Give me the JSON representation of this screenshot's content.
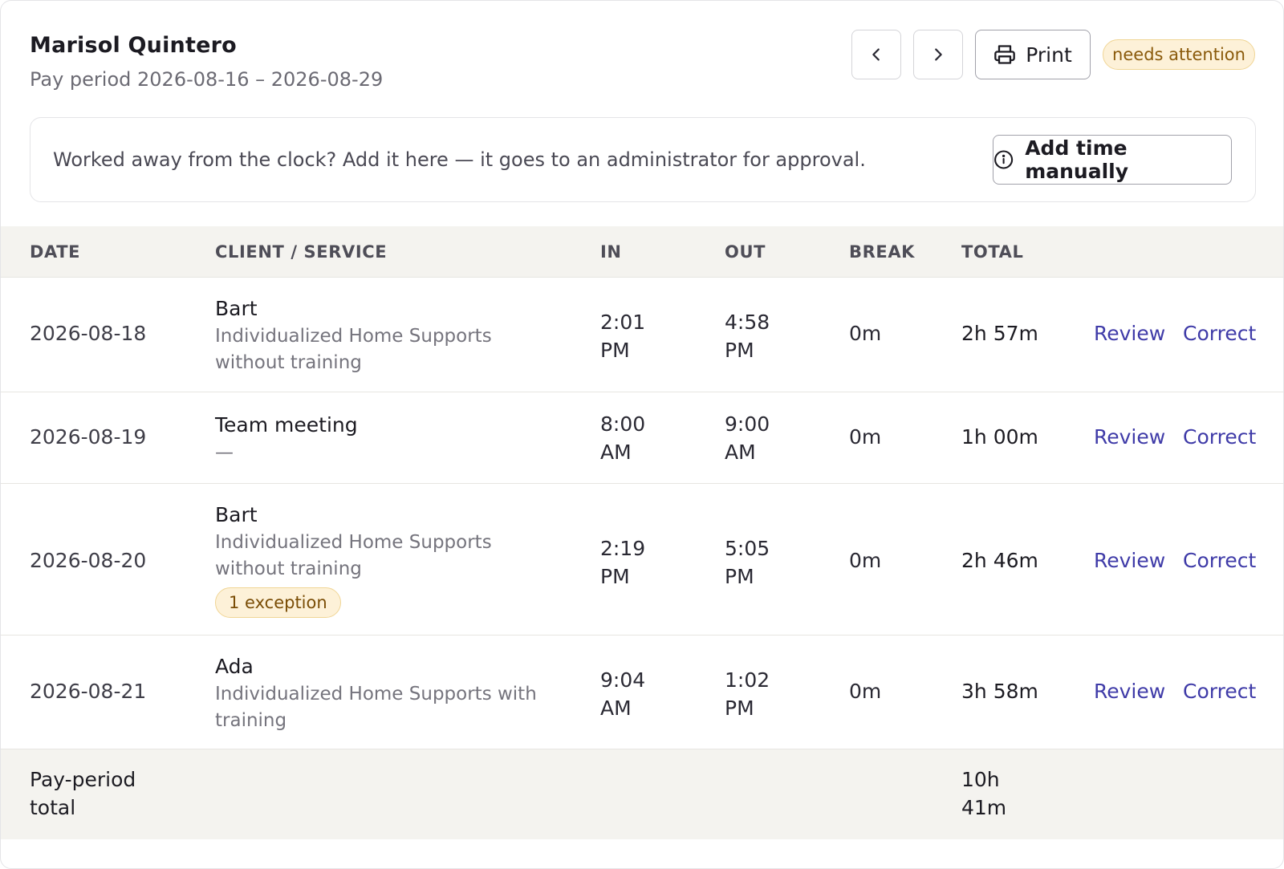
{
  "header": {
    "employee_name": "Marisol Quintero",
    "pay_period": "Pay period 2026-08-16 – 2026-08-29",
    "print_label": "Print",
    "status_badge": "needs attention"
  },
  "notice": {
    "text": "Worked away from the clock? Add it here — it goes to an administrator for approval.",
    "button_label": "Add time manually"
  },
  "table": {
    "columns": [
      "DATE",
      "CLIENT / SERVICE",
      "IN",
      "OUT",
      "BREAK",
      "TOTAL"
    ],
    "action_review": "Review",
    "action_correct": "Correct",
    "rows": [
      {
        "date": "2026-08-18",
        "client": "Bart",
        "service": "Individualized Home Supports without training",
        "in_time": "2:01",
        "in_ampm": "PM",
        "out_time": "4:58",
        "out_ampm": "PM",
        "break": "0m",
        "total": "2h 57m"
      },
      {
        "date": "2026-08-19",
        "client": "Team meeting",
        "service": "—",
        "in_time": "8:00",
        "in_ampm": "AM",
        "out_time": "9:00",
        "out_ampm": "AM",
        "break": "0m",
        "total": "1h 00m"
      },
      {
        "date": "2026-08-20",
        "client": "Bart",
        "service": "Individualized Home Supports without training",
        "in_time": "2:19",
        "in_ampm": "PM",
        "out_time": "5:05",
        "out_ampm": "PM",
        "break": "0m",
        "total": "2h 46m",
        "exception": "1 exception"
      },
      {
        "date": "2026-08-21",
        "client": "Ada",
        "service": "Individualized Home Supports with training",
        "in_time": "9:04",
        "in_ampm": "AM",
        "out_time": "1:02",
        "out_ampm": "PM",
        "break": "0m",
        "total": "3h 58m"
      }
    ],
    "footer_label": "Pay-period total",
    "footer_total": "10h 41m"
  },
  "colors": {
    "accent_link": "#3f3ba8",
    "badge_bg": "#fdf1d8",
    "badge_text": "#8a5a0b",
    "header_bg": "#f4f3ef"
  }
}
